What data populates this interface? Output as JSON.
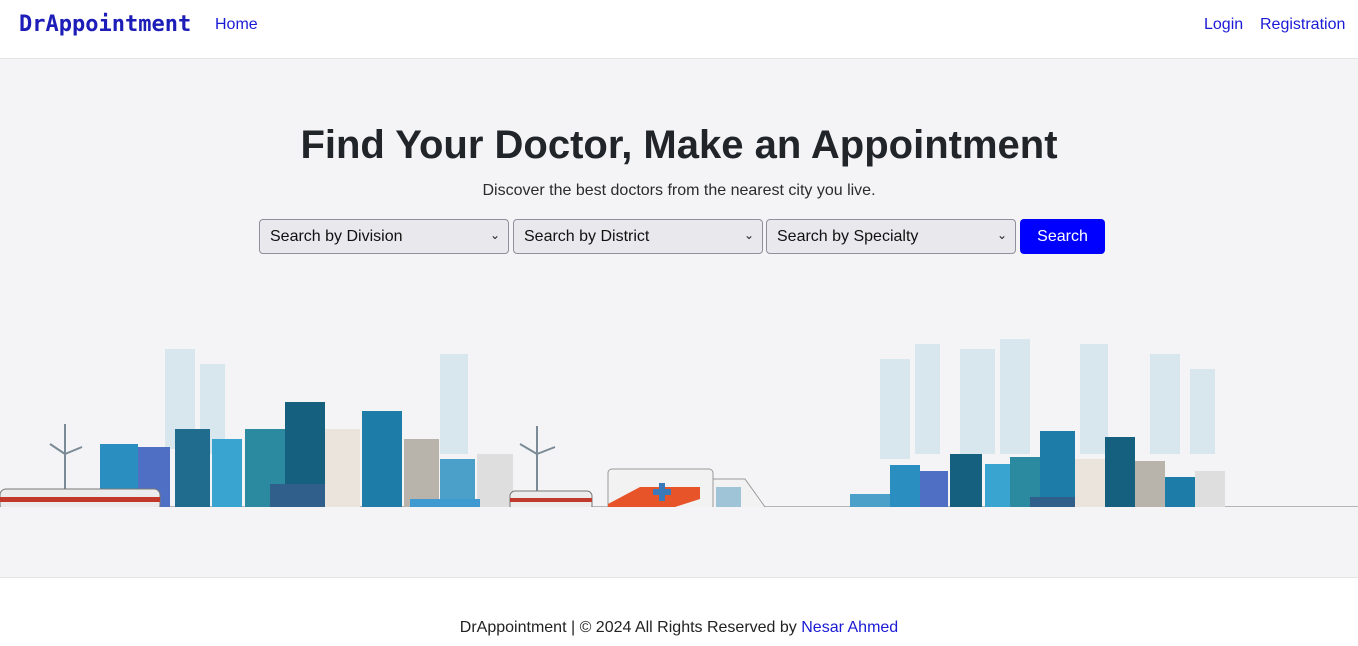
{
  "navbar": {
    "brand": "DrAppointment",
    "home": "Home",
    "login": "Login",
    "registration": "Registration"
  },
  "hero": {
    "title": "Find Your Doctor, Make an Appointment",
    "subtitle": "Discover the best doctors from the nearest city you live.",
    "filters": {
      "division": "Search by Division",
      "district": "Search by District",
      "specialty": "Search by Specialty"
    },
    "search_label": "Search"
  },
  "footer": {
    "text": "DrAppointment | © 2024 All Rights Reserved by",
    "author": "Nesar Ahmed"
  },
  "colors": {
    "brand": "#1d1db8",
    "link": "#1a1ad6",
    "button": "#0000ff",
    "hero_bg": "#f4f4f6"
  }
}
